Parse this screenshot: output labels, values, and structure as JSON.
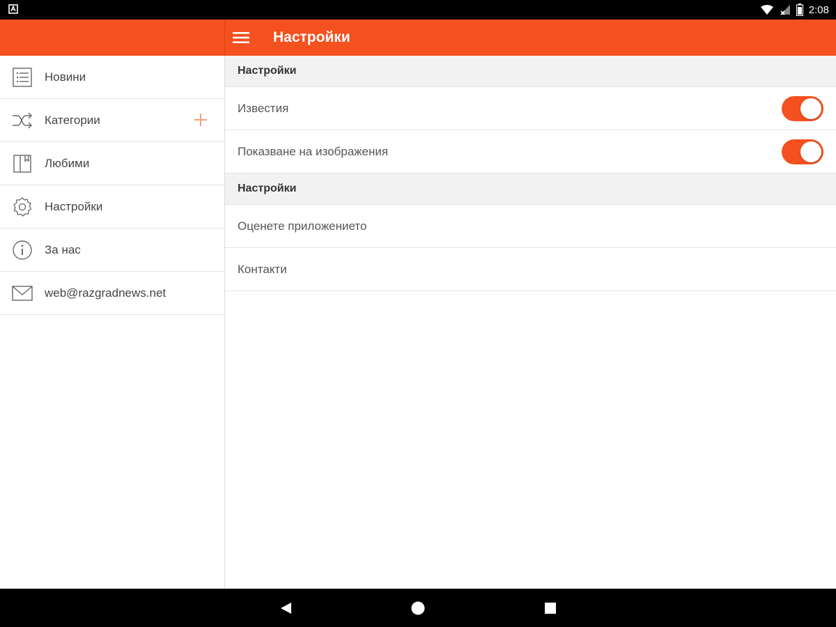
{
  "status_bar": {
    "time": "2:08"
  },
  "app_bar": {
    "title": "Настройки"
  },
  "drawer": {
    "items": [
      {
        "label": "Новини",
        "icon": "list-icon"
      },
      {
        "label": "Категории",
        "icon": "shuffle-icon"
      },
      {
        "label": "Любими",
        "icon": "bookmark-icon"
      },
      {
        "label": "Настройки",
        "icon": "gear-icon"
      },
      {
        "label": "За нас",
        "icon": "info-icon"
      },
      {
        "label": "web@razgradnews.net",
        "icon": "mail-icon"
      }
    ]
  },
  "settings": {
    "section1_title": "Настройки",
    "notifications_label": "Известия",
    "notifications_on": true,
    "show_images_label": "Показване на изображения",
    "show_images_on": true,
    "section2_title": "Настройки",
    "rate_label": "Оценете приложението",
    "contacts_label": "Контакти"
  },
  "colors": {
    "accent": "#f4511e",
    "status_bar": "#000000",
    "section_bg": "#f2f2f2"
  }
}
